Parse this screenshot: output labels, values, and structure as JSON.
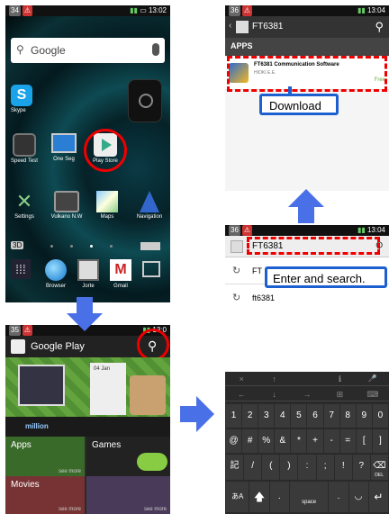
{
  "home": {
    "status_badge": "34",
    "time": "13:02",
    "search_placeholder": "Google",
    "apps_row1": [
      "Skype"
    ],
    "apps_row2": [
      "Speed Test",
      "One Seg",
      "Play Store"
    ],
    "apps_row3": [
      "Settings",
      "Vulkano N.W",
      "Maps",
      "Navigation"
    ],
    "dock": [
      "Browser",
      "Jorte",
      "Gmail"
    ],
    "dock_left": "3D"
  },
  "play": {
    "status_badge": "35",
    "time": "13:0",
    "title": "Google Play",
    "banner_brand": "million",
    "banner_date": "04 Jan",
    "categories": [
      "Apps",
      "Games",
      "Movies"
    ],
    "see_more": "see more"
  },
  "search": {
    "status_badge": "36",
    "time": "13:04",
    "query": "FT6381",
    "suggestions": [
      "FT",
      "ft6381"
    ],
    "callout": "Enter and search."
  },
  "results": {
    "status_badge": "36",
    "time": "13:04",
    "query": "FT6381",
    "section": "APPS",
    "app_title": "FT6381 Communication Software",
    "app_dev": "HIOKI E.E.",
    "app_price": "Free",
    "callout": "Download"
  },
  "keyboard": {
    "nav_row1": [
      "×",
      "↑",
      "",
      "ℹ",
      "🎤"
    ],
    "nav_row2": [
      "←",
      "↓",
      "→",
      "⊞",
      "⌨"
    ],
    "digits": [
      "1",
      "2",
      "3",
      "4",
      "5",
      "6",
      "7",
      "8",
      "9",
      "0"
    ],
    "symbols": [
      "@",
      "#",
      "%",
      "&",
      "*",
      "+",
      "-",
      "=",
      "[",
      "]"
    ],
    "row4": [
      "記号",
      "/",
      "(",
      ")",
      ":",
      ";",
      "!",
      "?",
      "⌫"
    ],
    "del_label": "DEL",
    "row5_left": "あA",
    "space_label": "space"
  }
}
